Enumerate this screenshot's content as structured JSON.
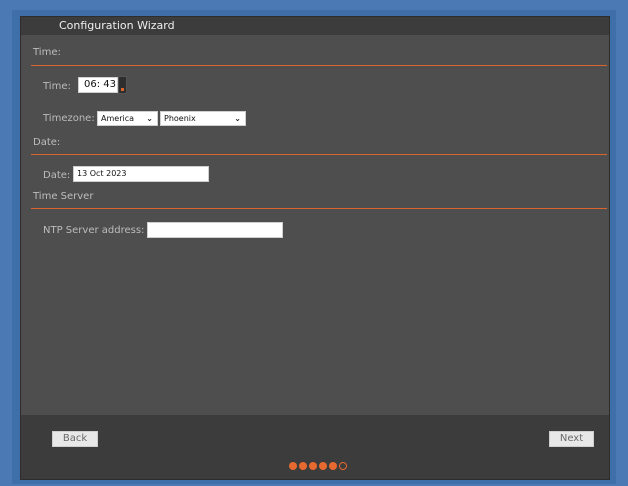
{
  "window": {
    "title": "Configuration Wizard"
  },
  "sections": {
    "time": {
      "header": "Time:",
      "time_label": "Time:",
      "time_value": "06: 43",
      "timezone_label": "Timezone:",
      "region": "America",
      "city": "Phoenix"
    },
    "date": {
      "header": "Date:",
      "date_label": "Date:",
      "date_value": "13 Oct 2023"
    },
    "time_server": {
      "header": "Time Server",
      "ntp_label": "NTP Server address:",
      "ntp_value": ""
    }
  },
  "footer": {
    "back_label": "Back",
    "next_label": "Next",
    "progress": {
      "current_step": 5,
      "total_steps": 6
    }
  },
  "colors": {
    "accent": "#e6692f",
    "background": "#4e4e4e",
    "title_bar": "#3c3c3c",
    "desktop": "#4a79b3"
  }
}
